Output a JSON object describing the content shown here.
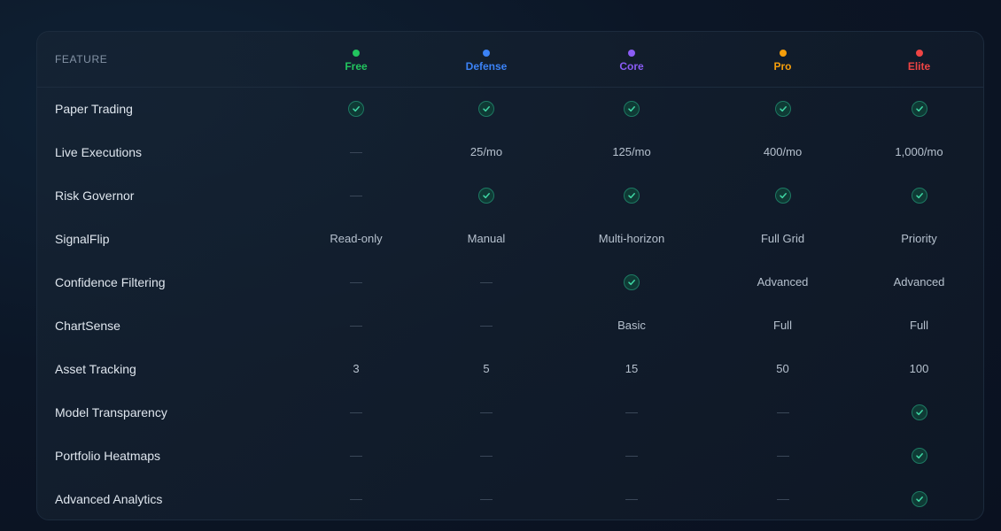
{
  "header": {
    "feature_label": "FEATURE",
    "tiers": [
      {
        "name": "Free",
        "color": "#22c55e"
      },
      {
        "name": "Defense",
        "color": "#3b82f6"
      },
      {
        "name": "Core",
        "color": "#8b5cf6"
      },
      {
        "name": "Pro",
        "color": "#f59e0b"
      },
      {
        "name": "Elite",
        "color": "#ef4444"
      }
    ]
  },
  "rows": [
    {
      "feature": "Paper Trading",
      "cells": [
        {
          "type": "check"
        },
        {
          "type": "check"
        },
        {
          "type": "check"
        },
        {
          "type": "check"
        },
        {
          "type": "check"
        }
      ]
    },
    {
      "feature": "Live Executions",
      "cells": [
        {
          "type": "dash"
        },
        {
          "type": "text",
          "value": "25/mo"
        },
        {
          "type": "text",
          "value": "125/mo"
        },
        {
          "type": "text",
          "value": "400/mo"
        },
        {
          "type": "text",
          "value": "1,000/mo"
        }
      ]
    },
    {
      "feature": "Risk Governor",
      "cells": [
        {
          "type": "dash"
        },
        {
          "type": "check"
        },
        {
          "type": "check"
        },
        {
          "type": "check"
        },
        {
          "type": "check"
        }
      ]
    },
    {
      "feature": "SignalFlip",
      "cells": [
        {
          "type": "text",
          "value": "Read-only"
        },
        {
          "type": "text",
          "value": "Manual"
        },
        {
          "type": "text",
          "value": "Multi-horizon"
        },
        {
          "type": "text",
          "value": "Full Grid"
        },
        {
          "type": "text",
          "value": "Priority"
        }
      ]
    },
    {
      "feature": "Confidence Filtering",
      "cells": [
        {
          "type": "dash"
        },
        {
          "type": "dash"
        },
        {
          "type": "check"
        },
        {
          "type": "text",
          "value": "Advanced"
        },
        {
          "type": "text",
          "value": "Advanced"
        }
      ]
    },
    {
      "feature": "ChartSense",
      "cells": [
        {
          "type": "dash"
        },
        {
          "type": "dash"
        },
        {
          "type": "text",
          "value": "Basic"
        },
        {
          "type": "text",
          "value": "Full"
        },
        {
          "type": "text",
          "value": "Full"
        }
      ]
    },
    {
      "feature": "Asset Tracking",
      "cells": [
        {
          "type": "text",
          "value": "3"
        },
        {
          "type": "text",
          "value": "5"
        },
        {
          "type": "text",
          "value": "15"
        },
        {
          "type": "text",
          "value": "50"
        },
        {
          "type": "text",
          "value": "100"
        }
      ]
    },
    {
      "feature": "Model Transparency",
      "cells": [
        {
          "type": "dash"
        },
        {
          "type": "dash"
        },
        {
          "type": "dash"
        },
        {
          "type": "dash"
        },
        {
          "type": "check"
        }
      ]
    },
    {
      "feature": "Portfolio Heatmaps",
      "cells": [
        {
          "type": "dash"
        },
        {
          "type": "dash"
        },
        {
          "type": "dash"
        },
        {
          "type": "dash"
        },
        {
          "type": "check"
        }
      ]
    },
    {
      "feature": "Advanced Analytics",
      "cells": [
        {
          "type": "dash"
        },
        {
          "type": "dash"
        },
        {
          "type": "dash"
        },
        {
          "type": "dash"
        },
        {
          "type": "check"
        }
      ]
    }
  ],
  "icons": {
    "check": "check-circle-icon",
    "dash": "dash-icon"
  }
}
